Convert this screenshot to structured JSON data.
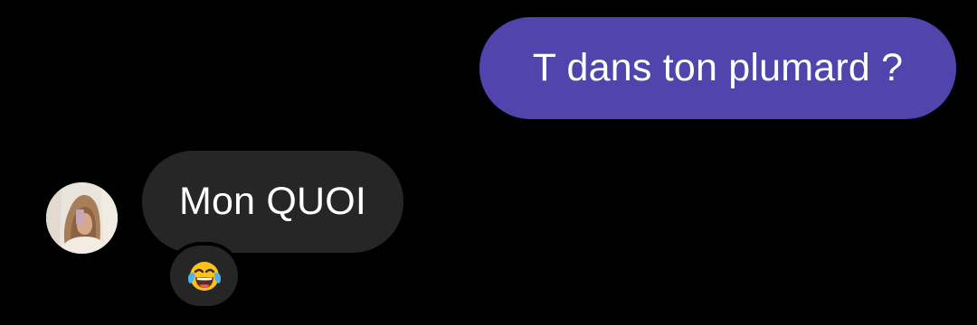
{
  "conversation": {
    "messages": [
      {
        "direction": "outgoing",
        "text": "T dans ton plumard ?",
        "color": "#5145ad"
      },
      {
        "direction": "incoming",
        "text": "Mon QUOI",
        "color": "#262626",
        "sender_avatar": "profile-photo",
        "reaction": "face-with-tears-of-joy-emoji"
      }
    ]
  },
  "theme": {
    "background": "#000000",
    "text_color": "#ffffff"
  }
}
